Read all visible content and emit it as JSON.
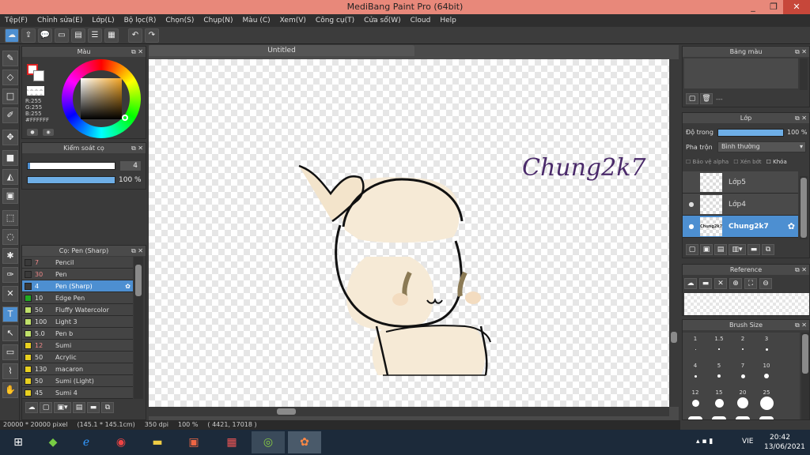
{
  "window": {
    "title": "MediBang Paint Pro (64bit)",
    "min": "_",
    "max": "❐",
    "close": "✕"
  },
  "menu": [
    "Tệp(F)",
    "Chỉnh sửa(E)",
    "Lớp(L)",
    "Bộ lọc(R)",
    "Chọn(S)",
    "Chụp(N)",
    "Màu (C)",
    "Xem(V)",
    "Công cụ(T)",
    "Cửa sổ(W)",
    "Cloud",
    "Help"
  ],
  "toolbar_icons": [
    "cloud-icon",
    "share-icon",
    "comment-icon",
    "chat-icon",
    "document-icon",
    "list-icon",
    "grid-icon",
    "undo-icon",
    "redo-icon"
  ],
  "canvas_tab": "Untitled",
  "color_panel": {
    "title": "Màu",
    "r": "R:255",
    "g": "G:255",
    "b": "B:255",
    "hex": "#FFFFFF"
  },
  "brush_control": {
    "title": "Kiểm soát cọ",
    "size": "4",
    "opacity": "100 %"
  },
  "brush_list": {
    "title": "Cọ: Pen (Sharp)",
    "items": [
      {
        "size": "7",
        "name": "Pencil",
        "color": "#3a3a3a",
        "size_color": "#e88"
      },
      {
        "size": "30",
        "name": "Pen",
        "color": "#3a3a3a",
        "size_color": "#e88"
      },
      {
        "size": "4",
        "name": "Pen (Sharp)",
        "color": "#3a3a3a",
        "size_color": "#e88",
        "selected": true
      },
      {
        "size": "10",
        "name": "Edge Pen",
        "color": "#22aa22",
        "size_color": "#ddd"
      },
      {
        "size": "50",
        "name": "Fluffy Watercolor",
        "color": "#bfe06a",
        "size_color": "#ddd"
      },
      {
        "size": "100",
        "name": "Light 3",
        "color": "#bfe06a",
        "size_color": "#ddd"
      },
      {
        "size": "5.0",
        "name": "Pen b",
        "color": "#bfe06a",
        "size_color": "#ddd"
      },
      {
        "size": "12",
        "name": "Sumi",
        "color": "#e8d020",
        "size_color": "#e88"
      },
      {
        "size": "50",
        "name": "Acrylic",
        "color": "#e8d020",
        "size_color": "#ddd"
      },
      {
        "size": "130",
        "name": "macaron",
        "color": "#e8d020",
        "size_color": "#ddd"
      },
      {
        "size": "50",
        "name": "Sumi (Light)",
        "color": "#e8d020",
        "size_color": "#ddd"
      },
      {
        "size": "45",
        "name": "Sumi 4",
        "color": "#e8d020",
        "size_color": "#ddd"
      }
    ]
  },
  "palette_panel": {
    "title": "Bảng màu",
    "empty": "---"
  },
  "layer_panel": {
    "title": "Lớp",
    "opacity_label": "Độ trong",
    "opacity_value": "100 %",
    "opacity_level": 1.0,
    "blend_label": "Pha trộn",
    "blend_value": "Bình thường",
    "protect_alpha": "Bảo vệ alpha",
    "clipping": "Xén bớt",
    "lock": "Khóa",
    "layers": [
      {
        "name": "Lớp5",
        "visible": false,
        "thumb": ""
      },
      {
        "name": "Lớp4",
        "visible": true,
        "thumb": ""
      },
      {
        "name": "Chung2k7",
        "visible": true,
        "thumb": "Chung2k7",
        "selected": true
      }
    ]
  },
  "reference_panel": {
    "title": "Reference"
  },
  "brush_size_panel": {
    "title": "Brush Size",
    "sizes": [
      "1",
      "1.5",
      "2",
      "3",
      "4",
      "5",
      "7",
      "10",
      "12",
      "15",
      "20",
      "25"
    ]
  },
  "canvas_text": "Chung2k7",
  "status": {
    "dimensions": "20000 * 20000 pixel",
    "physical": "(145.1 * 145.1cm)",
    "dpi": "350 dpi",
    "zoom": "100 %",
    "coords": "( 4421, 17018 )"
  },
  "taskbar": {
    "lang": "VIE",
    "time": "20:42",
    "date": "13/06/2021"
  }
}
